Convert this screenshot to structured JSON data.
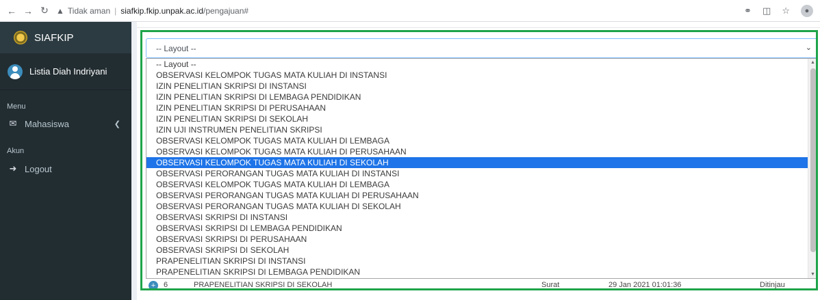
{
  "browser": {
    "security": "Tidak aman",
    "url_host": "siafkip.fkip.unpak.ac.id",
    "url_path": "/pengajuan#"
  },
  "sidebar": {
    "brand": "SIAFKIP",
    "user": "Listia Diah Indriyani",
    "menu_header": "Menu",
    "menu_item": "Mahasiswa",
    "account_header": "Akun",
    "logout": "Logout"
  },
  "select": {
    "value": "-- Layout --",
    "options": [
      "-- Layout --",
      "OBSERVASI KELOMPOK TUGAS MATA KULIAH DI INSTANSI",
      "IZIN PENELITIAN SKRIPSI DI INSTANSI",
      "IZIN PENELITIAN SKRIPSI DI LEMBAGA PENDIDIKAN",
      "IZIN PENELITIAN SKRIPSI DI PERUSAHAAN",
      "IZIN PENELITIAN SKRIPSI DI SEKOLAH",
      "IZIN UJI INSTRUMEN PENELITIAN SKRIPSI",
      "OBSERVASI KELOMPOK TUGAS MATA KULIAH DI LEMBAGA",
      "OBSERVASI KELOMPOK TUGAS MATA KULIAH DI PERUSAHAAN",
      "OBSERVASI KELOMPOK TUGAS MATA KULIAH DI SEKOLAH",
      "OBSERVASI PERORANGAN TUGAS MATA KULIAH DI INSTANSI",
      "OBSERVASI KELOMPOK TUGAS MATA KULIAH DI LEMBAGA",
      "OBSERVASI PERORANGAN TUGAS MATA KULIAH DI PERUSAHAAN",
      "OBSERVASI PERORANGAN TUGAS MATA KULIAH DI SEKOLAH",
      "OBSERVASI SKRIPSI DI INSTANSI",
      "OBSERVASI SKRIPSI DI LEMBAGA PENDIDIKAN",
      "OBSERVASI SKRIPSI DI PERUSAHAAN",
      "OBSERVASI SKRIPSI DI SEKOLAH",
      "PRAPENELITIAN SKRIPSI DI INSTANSI",
      "PRAPENELITIAN SKRIPSI DI LEMBAGA PENDIDIKAN"
    ],
    "selected_index": 9
  },
  "table_row": {
    "no": "6",
    "title": "PRAPENELITIAN SKRIPSI DI SEKOLAH",
    "type": "Surat",
    "date": "29 Jan 2021 01:01:36",
    "status": "Ditinjau"
  },
  "colors": {
    "highlight": "#1fa44a",
    "selected": "#1e74e8",
    "sidebar": "#222d32"
  }
}
